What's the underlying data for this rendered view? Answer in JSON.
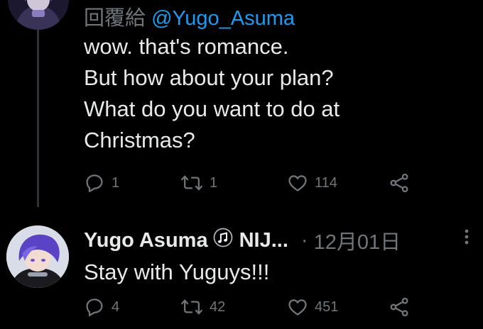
{
  "tweet1": {
    "reply_prefix": "回覆給",
    "reply_handle": "@Yugo_Asuma",
    "lines": [
      "wow. that's romance.",
      "But how about your plan?",
      "What do you want to do at",
      "Christmas?"
    ],
    "reply_count": "1",
    "retweet_count": "1",
    "like_count": "114"
  },
  "tweet2": {
    "author_name": "Yugo Asuma",
    "author_name_suffix": "NIJ...",
    "separator": "·",
    "date": "12月01日",
    "text": "Stay with Yuguys!!!",
    "reply_count": "4",
    "retweet_count": "42",
    "like_count": "451"
  },
  "icons": {
    "reply": "speech-bubble-icon",
    "retweet": "retweet-arrows-icon",
    "like": "heart-icon",
    "share": "share-nodes-icon",
    "more": "vertical-ellipsis-icon",
    "badge": "music-note-icon"
  },
  "colors": {
    "background": "#000000",
    "text": "#e7e9ea",
    "muted": "#71767b",
    "link": "#1d9bf0",
    "thread_line": "#2f3336"
  }
}
